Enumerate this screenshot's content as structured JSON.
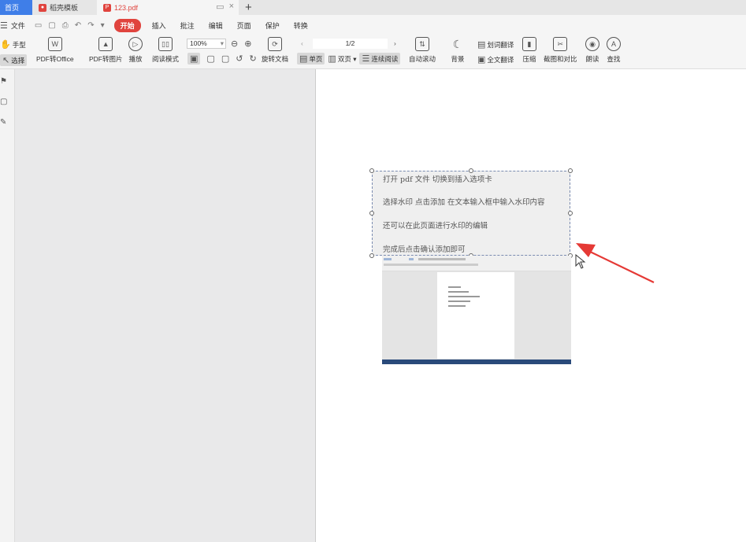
{
  "tabs": [
    {
      "label": "首页",
      "icon": "home"
    },
    {
      "label": "稻壳模板",
      "icon": "docer-logo-icon"
    },
    {
      "label": "123.pdf",
      "icon": "pdf-file-icon"
    }
  ],
  "menu": {
    "file": "文件",
    "items": [
      "开始",
      "插入",
      "批注",
      "编辑",
      "页面",
      "保护",
      "转换"
    ],
    "active": "开始"
  },
  "toolbar": {
    "hand": "手型",
    "select": "选择",
    "pdf_to_office": "PDF转Office",
    "pdf_to_image": "PDF转图片",
    "play": "播放",
    "read_mode": "阅读模式",
    "zoom": "100%",
    "rotate": "旋转文档",
    "page": "1/2",
    "single": "单页",
    "double": "双页",
    "continuous": "连续阅读",
    "autoscroll": "自动滚动",
    "background": "背景",
    "word_translate": "划词翻译",
    "full_translate": "全文翻译",
    "compress": "压缩",
    "screenshot_compare": "截图和对比",
    "read_aloud": "朗读",
    "find": "查找"
  },
  "watermark_lines": [
    "打开 pdf 文件    切换到插入选项卡",
    "选择水印      点击添加    在文本输入框中输入水印内容",
    "还可以在此页面进行水印的编辑",
    "完成后点击确认添加即可"
  ],
  "colors": {
    "tab_active": "#3f7ee8",
    "accent_red": "#e0443e",
    "arrow": "#e53935"
  }
}
